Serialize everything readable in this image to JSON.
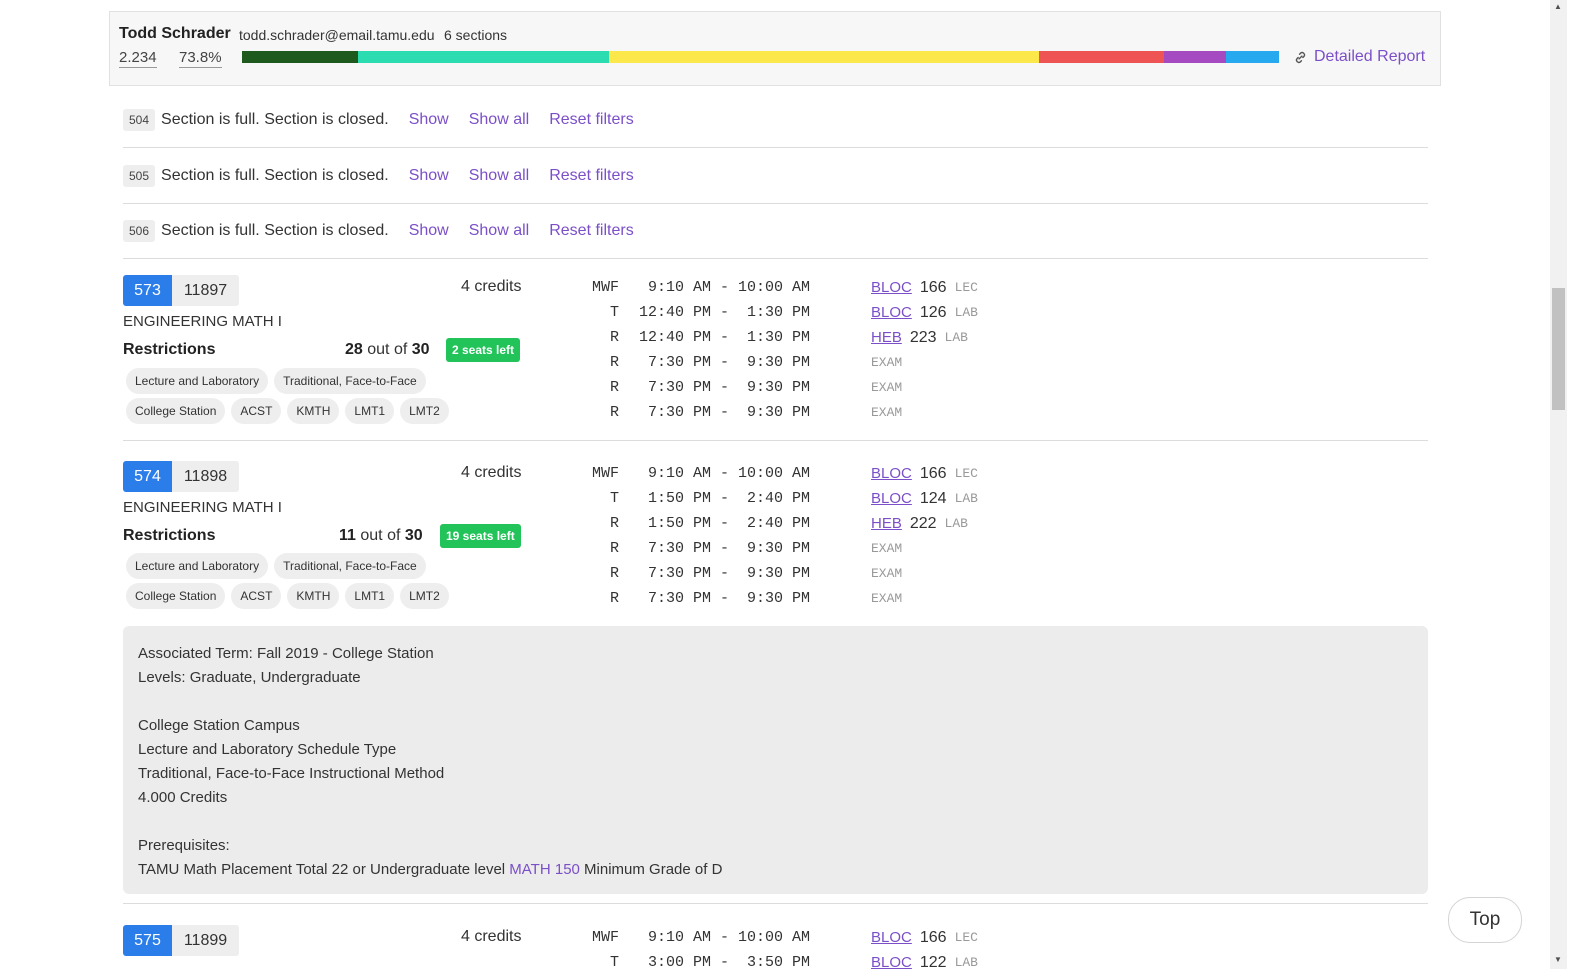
{
  "instructor": {
    "name": "Todd Schrader",
    "email": "todd.schrader@email.tamu.edu",
    "sections": "6 sections",
    "gpa": "2.234",
    "pass_rate": "73.8%",
    "grade_bar": [
      {
        "fraction": 0.112,
        "color": "#1e5a1e"
      },
      {
        "fraction": 0.242,
        "color": "#2bdcb0"
      },
      {
        "fraction": 0.415,
        "color": "#fde84c"
      },
      {
        "fraction": 0.12,
        "color": "#ef5454"
      },
      {
        "fraction": 0.06,
        "color": "#a54ac0"
      },
      {
        "fraction": 0.051,
        "color": "#27a9f0"
      }
    ],
    "report_label": "Detailed Report"
  },
  "closed_sections": [
    {
      "code": "504",
      "message": "Section is full. Section is closed.",
      "show": "Show",
      "show_all": "Show all",
      "reset": "Reset filters"
    },
    {
      "code": "505",
      "message": "Section is full. Section is closed.",
      "show": "Show",
      "show_all": "Show all",
      "reset": "Reset filters"
    },
    {
      "code": "506",
      "message": "Section is full. Section is closed.",
      "show": "Show",
      "show_all": "Show all",
      "reset": "Reset filters"
    }
  ],
  "sections": [
    {
      "number": "573",
      "crn": "11897",
      "credits": "4 credits",
      "title": "ENGINEERING MATH I",
      "restrictions_label": "Restrictions",
      "enrolled": "28",
      "out_of_text": "out of",
      "capacity": "30",
      "seats_left": "2 seats left",
      "chips_row1": [
        "Lecture and Laboratory",
        "Traditional, Face-to-Face"
      ],
      "chips_row2": [
        "College Station",
        "ACST",
        "KMTH",
        "LMT1",
        "LMT2"
      ],
      "meetings": [
        {
          "days": "MWF",
          "time": " 9:10 AM - 10:00 AM",
          "building": "BLOC",
          "room": "166",
          "type": "LEC"
        },
        {
          "days": "T",
          "time": "12:40 PM -  1:30 PM",
          "building": "BLOC",
          "room": "126",
          "type": "LAB"
        },
        {
          "days": "R",
          "time": "12:40 PM -  1:30 PM",
          "building": "HEB",
          "room": "223",
          "type": "LAB"
        },
        {
          "days": "R",
          "time": " 7:30 PM -  9:30 PM",
          "building": "",
          "room": "",
          "type": "EXAM"
        },
        {
          "days": "R",
          "time": " 7:30 PM -  9:30 PM",
          "building": "",
          "room": "",
          "type": "EXAM"
        },
        {
          "days": "R",
          "time": " 7:30 PM -  9:30 PM",
          "building": "",
          "room": "",
          "type": "EXAM"
        }
      ]
    },
    {
      "number": "574",
      "crn": "11898",
      "credits": "4 credits",
      "title": "ENGINEERING MATH I",
      "restrictions_label": "Restrictions",
      "enrolled": "11",
      "out_of_text": "out of",
      "capacity": "30",
      "seats_left": "19 seats left",
      "chips_row1": [
        "Lecture and Laboratory",
        "Traditional, Face-to-Face"
      ],
      "chips_row2": [
        "College Station",
        "ACST",
        "KMTH",
        "LMT1",
        "LMT2"
      ],
      "meetings": [
        {
          "days": "MWF",
          "time": " 9:10 AM - 10:00 AM",
          "building": "BLOC",
          "room": "166",
          "type": "LEC"
        },
        {
          "days": "T",
          "time": " 1:50 PM -  2:40 PM",
          "building": "BLOC",
          "room": "124",
          "type": "LAB"
        },
        {
          "days": "R",
          "time": " 1:50 PM -  2:40 PM",
          "building": "HEB",
          "room": "222",
          "type": "LAB"
        },
        {
          "days": "R",
          "time": " 7:30 PM -  9:30 PM",
          "building": "",
          "room": "",
          "type": "EXAM"
        },
        {
          "days": "R",
          "time": " 7:30 PM -  9:30 PM",
          "building": "",
          "room": "",
          "type": "EXAM"
        },
        {
          "days": "R",
          "time": " 7:30 PM -  9:30 PM",
          "building": "",
          "room": "",
          "type": "EXAM"
        }
      ]
    },
    {
      "number": "575",
      "crn": "11899",
      "credits": "4 credits",
      "meetings": [
        {
          "days": "MWF",
          "time": " 9:10 AM - 10:00 AM",
          "building": "BLOC",
          "room": "166",
          "type": "LEC"
        },
        {
          "days": "T",
          "time": " 3:00 PM -  3:50 PM",
          "building": "BLOC",
          "room": "122",
          "type": "LAB"
        }
      ]
    }
  ],
  "details": {
    "term": "Associated Term: Fall 2019 - College Station",
    "levels": "Levels: Graduate, Undergraduate",
    "campus": "College Station Campus",
    "schedule_type": "Lecture and Laboratory Schedule Type",
    "method": "Traditional, Face-to-Face Instructional Method",
    "credits": "4.000 Credits",
    "prereq_label": "Prerequisites:",
    "prereq_before": "TAMU Math Placement Total 22 or Undergraduate level ",
    "prereq_link": "MATH 150",
    "prereq_after": " Minimum Grade of D"
  },
  "top_button": "Top"
}
